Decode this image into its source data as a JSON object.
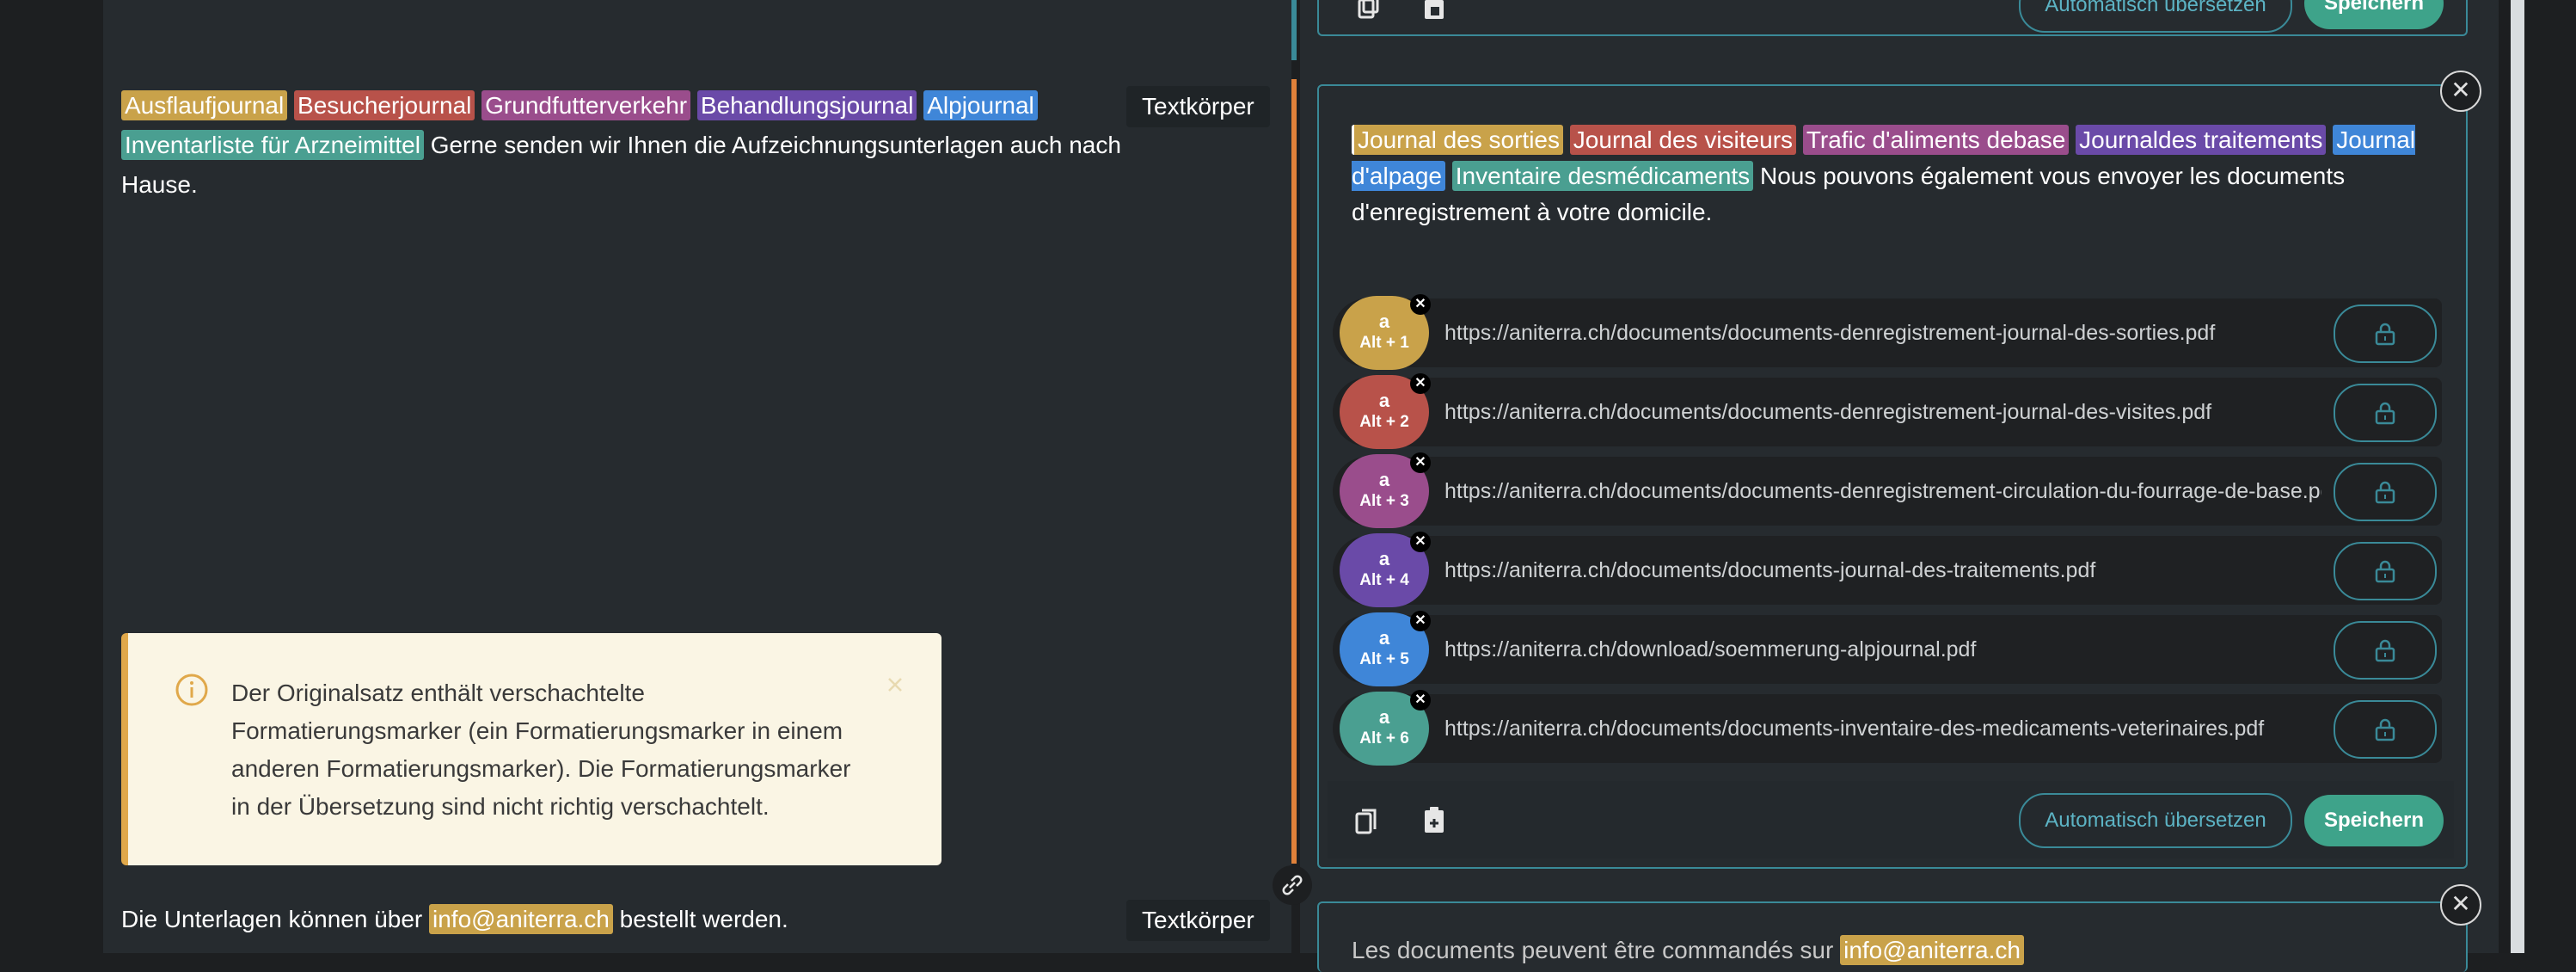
{
  "source": {
    "segment1": {
      "markers": [
        "Ausflaufjournal",
        "Besucherjournal",
        "Grundfutterverkehr",
        "Behandlungsjournal",
        "Alpjournal",
        "Inventarliste für Arzneimittel"
      ],
      "text": "Gerne senden wir Ihnen die Aufzeichnungsunterlagen auch nach Hause.",
      "tag": "Textkörper"
    },
    "segment2": {
      "before": "Die Unterlagen können über",
      "marker": "info@aniterra.ch",
      "after": "bestellt werden.",
      "tag": "Textkörper"
    }
  },
  "warning": {
    "text": "Der Originalsatz enthält verschachtelte Formatierungsmarker (ein Formatierungsmarker in einem anderen Formatierungsmarker). Die Formatierungsmarker in der Übersetzung sind nicht richtig verschachtelt."
  },
  "target": {
    "markers": [
      "Journal des sorties",
      "Journal des visiteurs",
      "Trafic d'aliments debase",
      "Journaldes traitements",
      "Journal d'alpage",
      "Inventaire desmédicaments"
    ],
    "text": "Nous pouvons également vous envoyer les documents d'enregistrement à votre domicile.",
    "links": [
      {
        "key_letter": "a",
        "hotkey": "Alt + 1",
        "url": "https://aniterra.ch/documents/documents-denregistrement-journal-des-sorties.pdf",
        "color": "#c9a24a"
      },
      {
        "key_letter": "a",
        "hotkey": "Alt + 2",
        "url": "https://aniterra.ch/documents/documents-denregistrement-journal-des-visites.pdf",
        "color": "#b8524a"
      },
      {
        "key_letter": "a",
        "hotkey": "Alt + 3",
        "url": "https://aniterra.ch/documents/documents-denregistrement-circulation-du-fourrage-de-base.pdf",
        "color": "#9a4d8c"
      },
      {
        "key_letter": "a",
        "hotkey": "Alt + 4",
        "url": "https://aniterra.ch/documents/documents-journal-des-traitements.pdf",
        "color": "#6a4aa8"
      },
      {
        "key_letter": "a",
        "hotkey": "Alt + 5",
        "url": "https://aniterra.ch/download/soemmerung-alpjournal.pdf",
        "color": "#3f86d8"
      },
      {
        "key_letter": "a",
        "hotkey": "Alt + 6",
        "url": "https://aniterra.ch/documents/documents-inventaire-des-medicaments-veterinaires.pdf",
        "color": "#4a9f91"
      }
    ],
    "auto_translate_label": "Automatisch übersetzen",
    "save_label": "Speichern"
  },
  "next_target": {
    "text_before": "Les documents peuvent être commandés sur",
    "marker": "info@aniterra.ch"
  },
  "icons": {
    "copy": "copy-icon",
    "paste": "paste-icon",
    "lock": "lock-icon",
    "info": "info-icon",
    "close": "close-icon",
    "link": "link-icon"
  }
}
